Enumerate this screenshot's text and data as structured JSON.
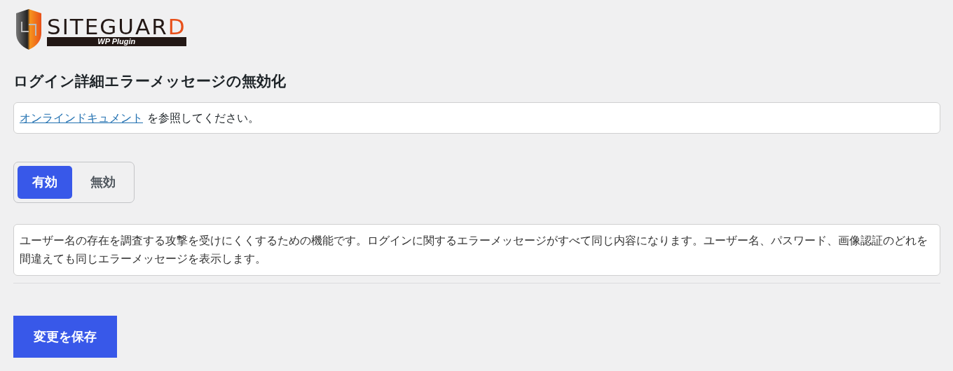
{
  "logo": {
    "name": "SITEGUARD",
    "tagline": "WP Plugin"
  },
  "title": "ログイン詳細エラーメッセージの無効化",
  "doc_notice": {
    "link": "オンラインドキュメント",
    "text": "を参照してください。"
  },
  "toggle": [
    {
      "label": "有効",
      "selected": true
    },
    {
      "label": "無効",
      "selected": false
    }
  ],
  "description": "ユーザー名の存在を調査する攻撃を受けにくくするための機能です。ログインに関するエラーメッセージがすべて同じ内容になります。ユーザー名、パスワード、画像認証のどれを間違えても同じエラーメッセージを表示します。",
  "save_button": "変更を保存"
}
